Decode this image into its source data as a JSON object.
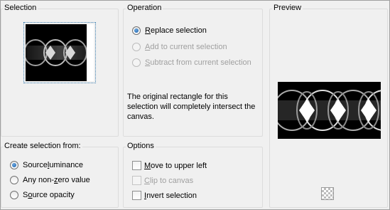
{
  "selection": {
    "title": "Selection"
  },
  "operation": {
    "title": "Operation",
    "options": [
      {
        "pre": "",
        "u": "R",
        "post": "eplace selection",
        "checked": true,
        "enabled": true
      },
      {
        "pre": "",
        "u": "A",
        "post": "dd to current selection",
        "checked": false,
        "enabled": false
      },
      {
        "pre": "",
        "u": "S",
        "post": "ubtract from current selection",
        "checked": false,
        "enabled": false
      }
    ],
    "note": "The original rectangle for this selection will completely intersect the canvas."
  },
  "preview": {
    "title": "Preview",
    "icon": "checkerboard-icon"
  },
  "create_from": {
    "title": "Create selection from:",
    "options": [
      {
        "pre": "Source ",
        "u": "l",
        "post": "uminance",
        "checked": true
      },
      {
        "pre": "Any non-",
        "u": "z",
        "post": "ero value",
        "checked": false
      },
      {
        "pre": "S",
        "u": "o",
        "post": "urce opacity",
        "checked": false
      }
    ]
  },
  "options": {
    "title": "Options",
    "checks": [
      {
        "pre": "",
        "u": "M",
        "post": "ove to upper left",
        "checked": false,
        "enabled": true
      },
      {
        "pre": "",
        "u": "C",
        "post": "lip to canvas",
        "checked": false,
        "enabled": false
      },
      {
        "pre": "",
        "u": "I",
        "post": "nvert selection",
        "checked": false,
        "enabled": true
      }
    ]
  },
  "colors": {
    "radio_fill": "#1c5fa8",
    "focus_border": "#3c7fb1",
    "preview_bg": "#000000"
  }
}
